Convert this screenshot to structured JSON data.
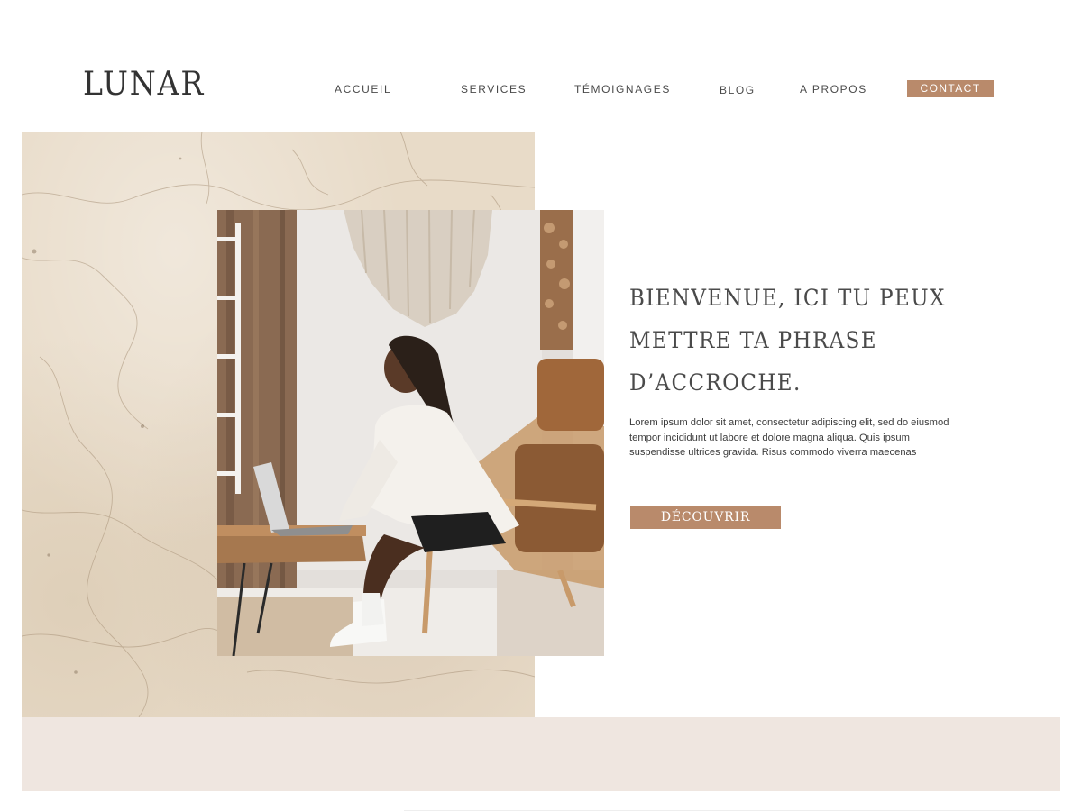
{
  "header": {
    "logo": "LUNAR",
    "nav": [
      {
        "label": "ACCUEIL"
      },
      {
        "label": "SERVICES"
      },
      {
        "label": "TÉMOIGNAGES"
      },
      {
        "label": "BLOG"
      },
      {
        "label": "A PROPOS"
      }
    ],
    "contact_label": "CONTACT"
  },
  "hero": {
    "title": "BIENVENUE, ICI TU PEUX METTRE TA PHRASE D’ACCROCHE.",
    "body": "Lorem ipsum dolor sit amet, consectetur adipiscing elit, sed do eiusmod tempor incididunt ut labore et dolore magna aliqua. Quis ipsum suspendisse ultrices gravida. Risus commodo viverra maecenas",
    "cta_label": "DÉCOUVRIR"
  },
  "colors": {
    "accent": "#b98a6b",
    "texture": "#e8dbc8",
    "band": "#efe6e0",
    "text": "#4a4a4a"
  }
}
